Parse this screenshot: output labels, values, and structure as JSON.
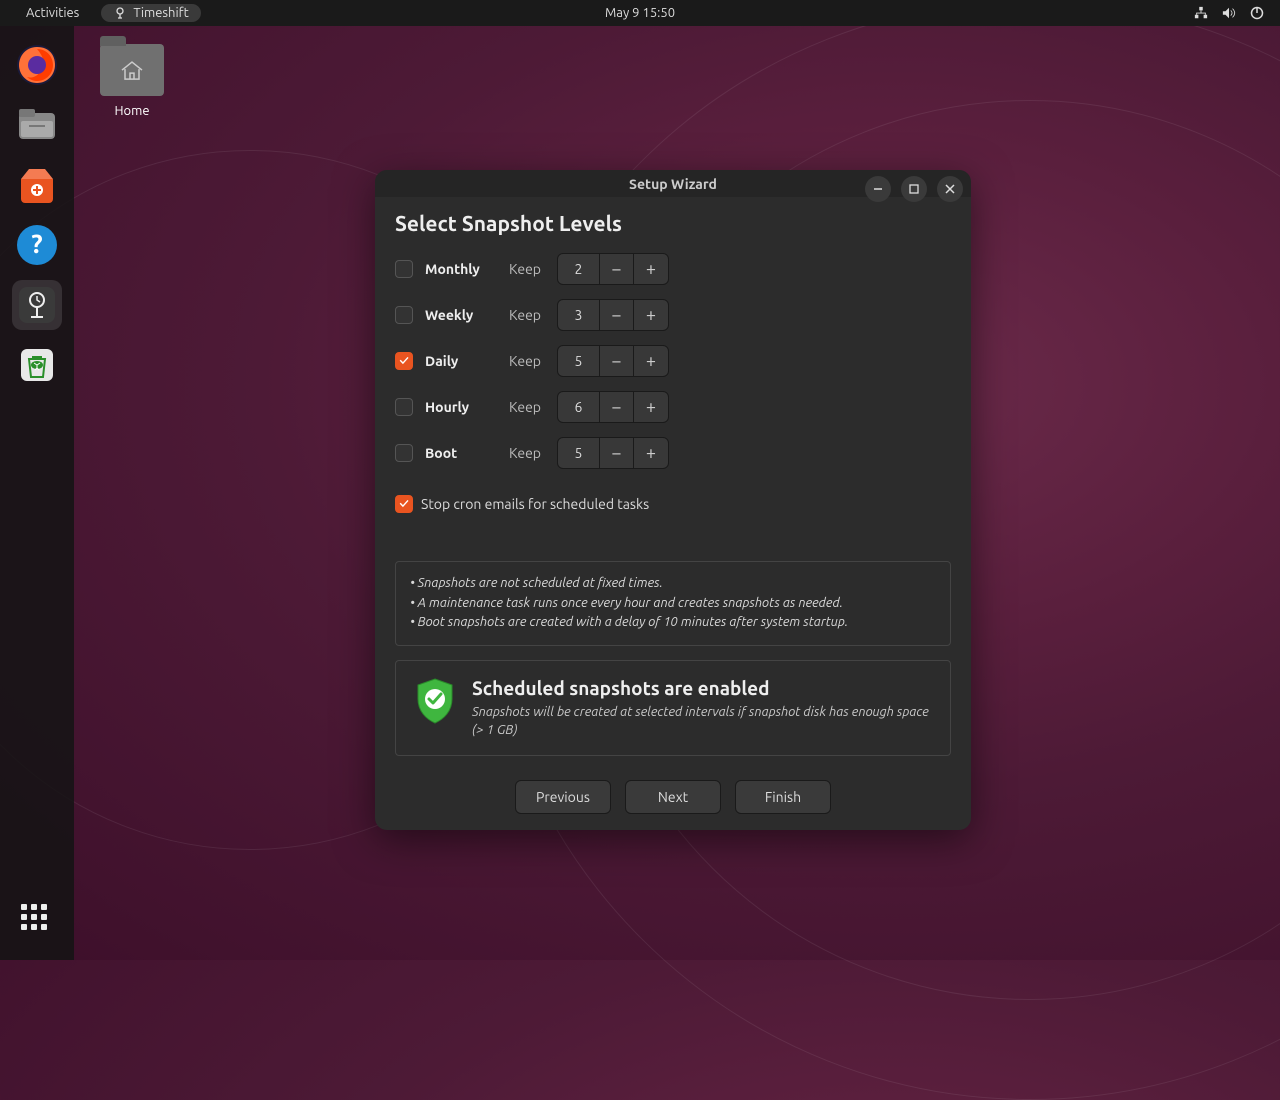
{
  "topbar": {
    "activities": "Activities",
    "app_name": "Timeshift",
    "datetime": "May 9  15:50"
  },
  "desktop": {
    "home_label": "Home"
  },
  "dock": {
    "items": [
      "firefox",
      "files",
      "software",
      "help",
      "timeshift",
      "trash"
    ]
  },
  "window": {
    "title": "Setup Wizard",
    "heading": "Select Snapshot Levels",
    "levels": [
      {
        "name": "Monthly",
        "checked": false,
        "keep": 2
      },
      {
        "name": "Weekly",
        "checked": false,
        "keep": 3
      },
      {
        "name": "Daily",
        "checked": true,
        "keep": 5
      },
      {
        "name": "Hourly",
        "checked": false,
        "keep": 6
      },
      {
        "name": "Boot",
        "checked": false,
        "keep": 5
      }
    ],
    "keep_label": "Keep",
    "cron_stop": {
      "checked": true,
      "label": "Stop cron emails for scheduled tasks"
    },
    "hints": [
      "Snapshots are not scheduled at fixed times.",
      "A maintenance task runs once every hour and creates snapshots as needed.",
      "Boot snapshots are created with a delay of 10 minutes after system startup."
    ],
    "status": {
      "title": "Scheduled snapshots are enabled",
      "desc": "Snapshots will be created at selected intervals if snapshot disk has enough space (> 1 GB)"
    },
    "buttons": {
      "previous": "Previous",
      "next": "Next",
      "finish": "Finish"
    }
  }
}
